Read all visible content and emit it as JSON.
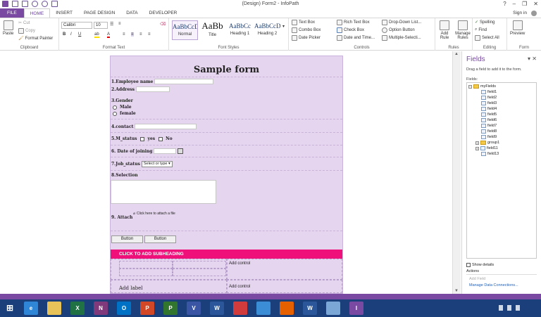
{
  "window": {
    "title": "(Design) Form2 - InfoPath",
    "controls": [
      "?",
      "–",
      "❐",
      "✕"
    ]
  },
  "tabs": [
    {
      "label": "FILE"
    },
    {
      "label": "HOME"
    },
    {
      "label": "INSERT"
    },
    {
      "label": "PAGE DESIGN"
    },
    {
      "label": "DATA"
    },
    {
      "label": "DEVELOPER"
    }
  ],
  "account": {
    "signin": "Sign in"
  },
  "ribbon": {
    "clipboard": {
      "paste": "Paste",
      "cut": "Cut",
      "copy": "Copy",
      "format_painter": "Format Painter",
      "label": "Clipboard"
    },
    "format_text": {
      "font": "Calibri",
      "size": "10",
      "bold": "B",
      "italic": "I",
      "underline": "U",
      "label": "Format Text"
    },
    "font_styles": {
      "cards": [
        {
          "sample": "AaBbCcDd",
          "name": "Normal"
        },
        {
          "sample": "AaBb",
          "name": "Title"
        },
        {
          "sample": "AaBbCc",
          "name": "Heading 1"
        },
        {
          "sample": "AaBbCcDc",
          "name": "Heading 2"
        }
      ],
      "label": "Font Styles"
    },
    "controls": {
      "items": [
        "Text Box",
        "Combo Box",
        "Date Picker",
        "Rich Text Box",
        "Check Box",
        "Date and Time...",
        "Drop-Down List...",
        "Option Button",
        "Multiple-Selecti..."
      ],
      "label": "Controls"
    },
    "rules": {
      "add_rule": "Add Rule",
      "manage_rules": "Manage Rules",
      "label": "Rules"
    },
    "editing": {
      "spelling": "Spelling",
      "find": "Find",
      "select_all": "Select All",
      "label": "Editing"
    },
    "form": {
      "preview": "Preview",
      "label": "Form"
    }
  },
  "form": {
    "title": "Sample form",
    "employee_name": "1.Employee name",
    "address": "2.Address",
    "gender": "3.Gender",
    "male": "Male",
    "female": "female",
    "contact": "4.contact",
    "m_status": "5.M_status",
    "yes": "yes",
    "no": "No",
    "date_joining": "6. Date of joining",
    "job_status": "7.Job_status",
    "job_select": "Select or type",
    "selection": "8.Selection",
    "attach": "9. Attach",
    "attach_hint": "Click here to attach a file",
    "button1": "Button",
    "button2": "Button",
    "subheading": "CLICK TO ADD SUBHEADING",
    "add_control_1": "Add control",
    "add_label": "Add label",
    "add_control_2": "Add control"
  },
  "fields_pane": {
    "title": "Fields",
    "hint": "Drag a field to add it to the form.",
    "fields_label": "Fields:",
    "root": "myFields",
    "items": [
      "field1",
      "field2",
      "field3",
      "field4",
      "field5",
      "field6",
      "field7",
      "field8",
      "field9",
      "group1",
      "field11",
      "field13"
    ],
    "show_details": "Show details",
    "actions": "Actions",
    "add_field": "Add Field",
    "manage_connections": "Manage Data Connections..."
  },
  "taskbar": {
    "apps": [
      {
        "icon": "ie-icon",
        "letter": "e",
        "color": "#2f86d6"
      },
      {
        "icon": "explorer-icon",
        "letter": "",
        "color": "#e8c35a"
      },
      {
        "icon": "excel-icon",
        "letter": "X",
        "color": "#207245"
      },
      {
        "icon": "onenote-icon",
        "letter": "N",
        "color": "#80397b"
      },
      {
        "icon": "outlook-icon",
        "letter": "O",
        "color": "#0072c6"
      },
      {
        "icon": "powerpoint-icon",
        "letter": "P",
        "color": "#d24726"
      },
      {
        "icon": "project-icon",
        "letter": "P",
        "color": "#31752f"
      },
      {
        "icon": "visio-icon",
        "letter": "V",
        "color": "#3955a3"
      },
      {
        "icon": "word-icon",
        "letter": "W",
        "color": "#2b579a"
      },
      {
        "icon": "mail-icon",
        "letter": "",
        "color": "#d23b3b"
      },
      {
        "icon": "lync-icon",
        "letter": "",
        "color": "#3b8ed6"
      },
      {
        "icon": "firefox-icon",
        "letter": "",
        "color": "#e66000"
      },
      {
        "icon": "word2-icon",
        "letter": "W",
        "color": "#2b579a"
      },
      {
        "icon": "folder-icon",
        "letter": "",
        "color": "#7aa7d6"
      },
      {
        "icon": "infopath-icon",
        "letter": "I",
        "color": "#7a4aa3"
      }
    ]
  }
}
